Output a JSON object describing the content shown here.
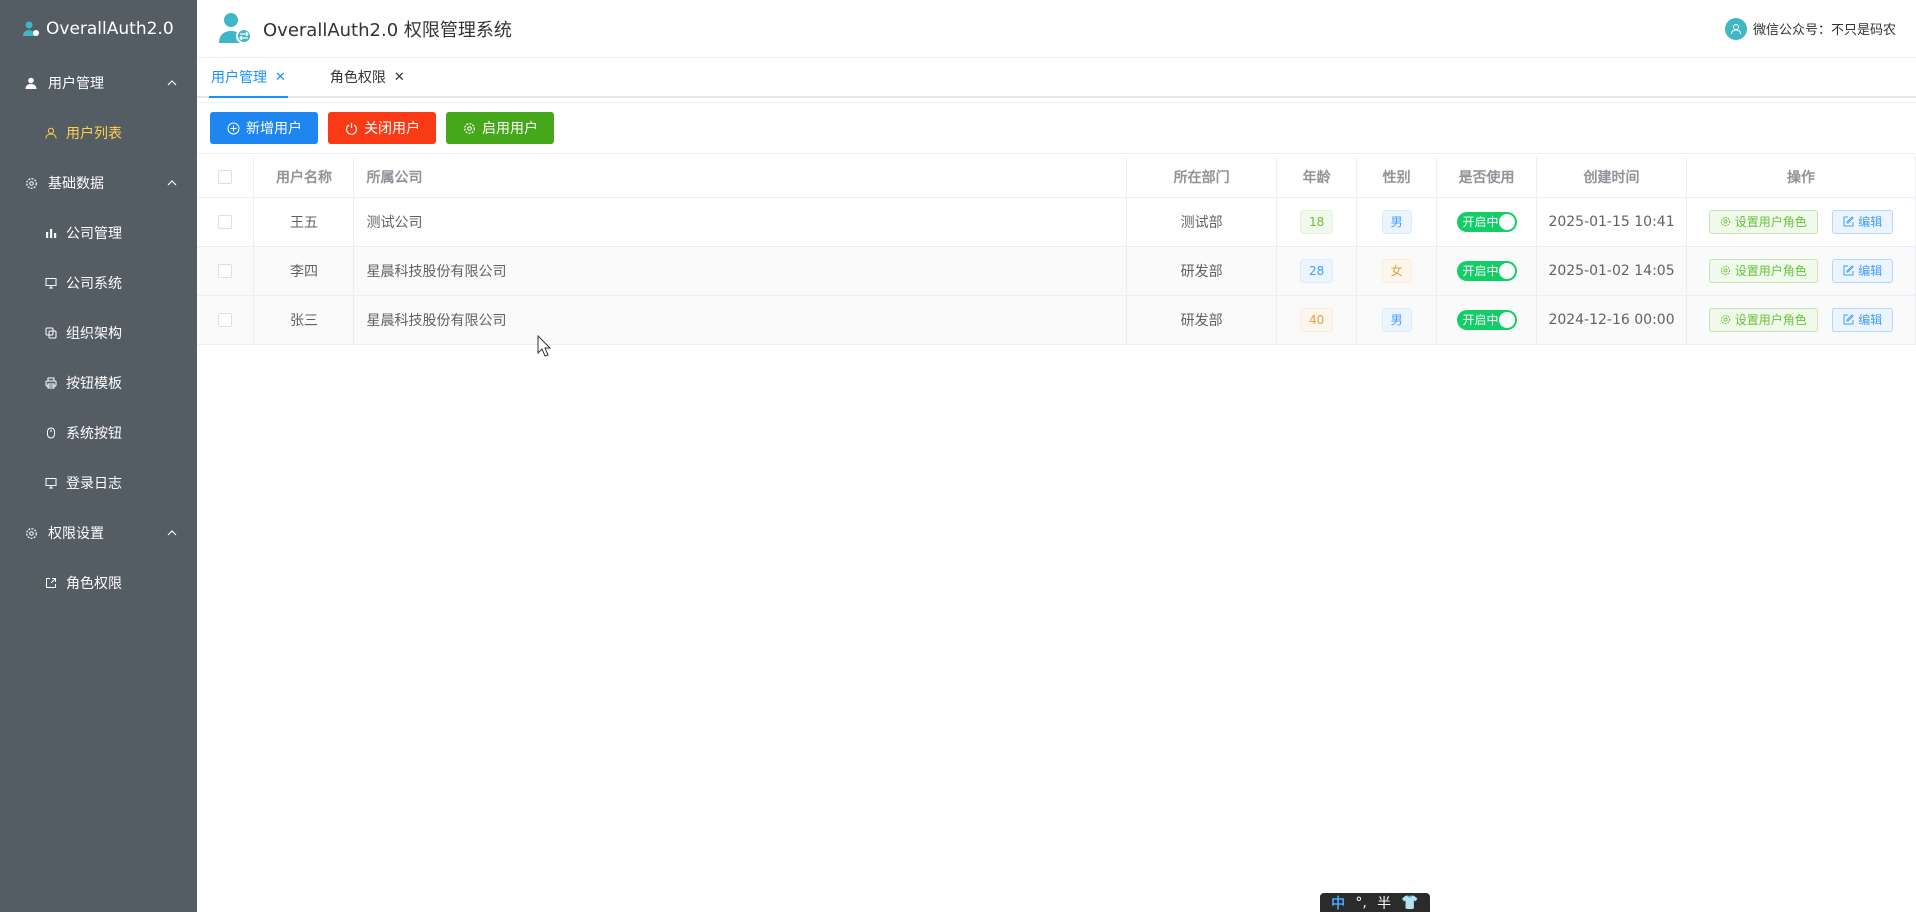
{
  "brand": {
    "name": "OverallAuth2.0"
  },
  "header": {
    "title": "OverallAuth2.0 权限管理系统",
    "user_text": "微信公众号：不只是码农"
  },
  "sidebar": {
    "groups": [
      {
        "label": "用户管理",
        "icon": "user-icon",
        "items": [
          {
            "label": "用户列表",
            "icon": "user-outline-icon",
            "active": true
          }
        ]
      },
      {
        "label": "基础数据",
        "icon": "gear-icon",
        "items": [
          {
            "label": "公司管理",
            "icon": "bar-chart-icon"
          },
          {
            "label": "公司系统",
            "icon": "monitor-icon"
          },
          {
            "label": "组织架构",
            "icon": "copy-icon"
          },
          {
            "label": "按钮模板",
            "icon": "printer-icon"
          },
          {
            "label": "系统按钮",
            "icon": "mouse-icon"
          },
          {
            "label": "登录日志",
            "icon": "monitor-icon"
          }
        ]
      },
      {
        "label": "权限设置",
        "icon": "gear-icon",
        "items": [
          {
            "label": "角色权限",
            "icon": "export-icon"
          }
        ]
      }
    ]
  },
  "tabs": [
    {
      "label": "用户管理",
      "active": true
    },
    {
      "label": "角色权限",
      "active": false
    }
  ],
  "toolbar": {
    "add_label": "新增用户",
    "close_label": "关闭用户",
    "enable_label": "启用用户"
  },
  "table": {
    "headers": [
      "用户名称",
      "所属公司",
      "所在部门",
      "年龄",
      "性别",
      "是否使用",
      "创建时间",
      "操作"
    ],
    "rows": [
      {
        "name": "王五",
        "company": "测试公司",
        "dept": "测试部",
        "age": "18",
        "gender": "男",
        "status": "开启中",
        "created": "2025-01-15 10:41"
      },
      {
        "name": "李四",
        "company": "星晨科技股份有限公司",
        "dept": "研发部",
        "age": "28",
        "gender": "女",
        "status": "开启中",
        "created": "2025-01-02 14:05"
      },
      {
        "name": "张三",
        "company": "星晨科技股份有限公司",
        "dept": "研发部",
        "age": "40",
        "gender": "男",
        "status": "开启中",
        "created": "2024-12-16 00:00"
      }
    ],
    "op_role_label": "设置用户角色",
    "op_edit_label": "编辑"
  },
  "ime": {
    "lang": "中",
    "punct": "°,",
    "width": "半",
    "skin": "👕"
  },
  "colors": {
    "sidebar_bg": "#545c64",
    "active_menu": "#ffd04b",
    "primary": "#1e86f0",
    "danger": "#fa3a14",
    "success": "#45a81b"
  }
}
